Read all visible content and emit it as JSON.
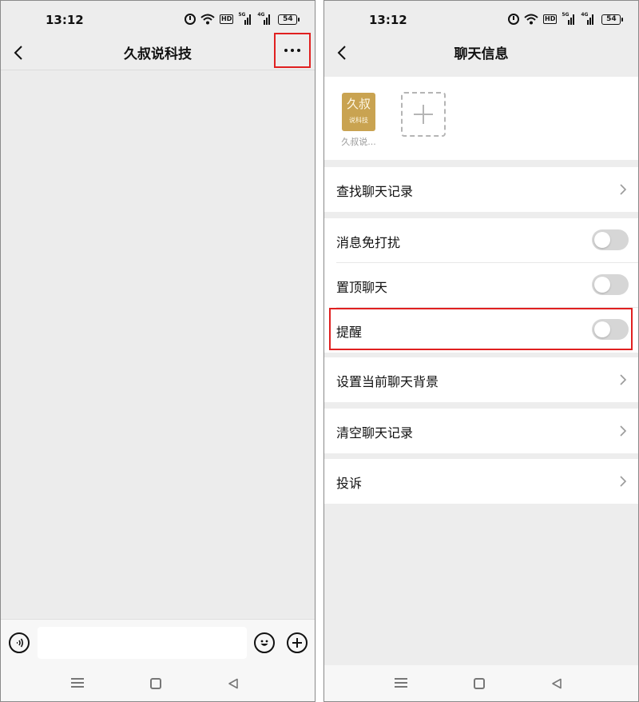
{
  "status_bar": {
    "time": "13:12",
    "battery": "54",
    "network_1": "5G",
    "network_2": "4G",
    "hd_label": "HD"
  },
  "left_screen": {
    "title": "久叔说科技",
    "input_placeholder": "",
    "highlight_color": "#e02020"
  },
  "right_screen": {
    "title": "聊天信息",
    "member": {
      "avatar_line1": "久叔",
      "avatar_line2": "说科技",
      "name": "久叔说..."
    },
    "rows": {
      "search_history": "查找聊天记录",
      "mute": "消息免打扰",
      "pin": "置顶聊天",
      "remind": "提醒",
      "background": "设置当前聊天背景",
      "clear_history": "清空聊天记录",
      "report": "投诉"
    },
    "toggles": {
      "mute": "off",
      "pin": "off",
      "remind": "off"
    }
  },
  "colors": {
    "page_bg": "#ededed",
    "avatar_gold": "#c9a351",
    "highlight_red": "#e02020"
  }
}
